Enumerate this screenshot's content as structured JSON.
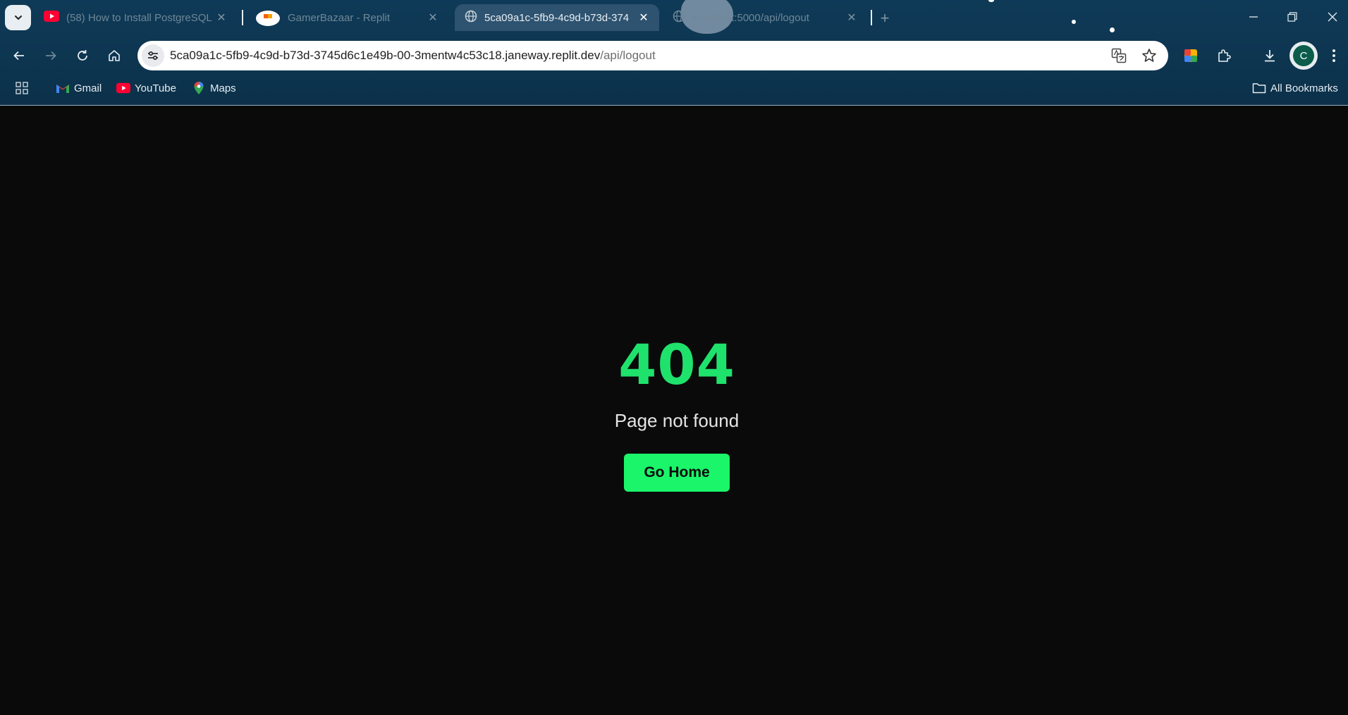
{
  "browser": {
    "tabs": [
      {
        "title": "(58) How to Install PostgreSQL",
        "icon": "youtube-icon",
        "active": false
      },
      {
        "title": "GamerBazaar - Replit",
        "icon": "replit-icon",
        "active": false
      },
      {
        "title": "5ca09a1c-5fb9-4c9d-b73d-374",
        "icon": "globe-icon",
        "active": true
      },
      {
        "title": "localhost:5000/api/logout",
        "icon": "globe-icon",
        "active": false
      }
    ],
    "address_bar": {
      "host": "5ca09a1c-5fb9-4c9d-b73d-3745d6c1e49b-00-3mentw4c53c18.janeway.replit.dev",
      "path": "/api/logout"
    },
    "profile_initial": "C",
    "bookmarks": [
      {
        "label": "Gmail",
        "icon": "gmail-icon"
      },
      {
        "label": "YouTube",
        "icon": "youtube-icon"
      },
      {
        "label": "Maps",
        "icon": "maps-icon"
      }
    ],
    "all_bookmarks_label": "All Bookmarks",
    "colors": {
      "chrome_bg": "#0f3a57",
      "active_tab": "#2e5370"
    }
  },
  "page": {
    "error_code": "404",
    "message": "Page not found",
    "home_button_label": "Go Home",
    "colors": {
      "background": "#0a0a0a",
      "accent": "#1af56a",
      "text": "#e4e4e4"
    }
  }
}
